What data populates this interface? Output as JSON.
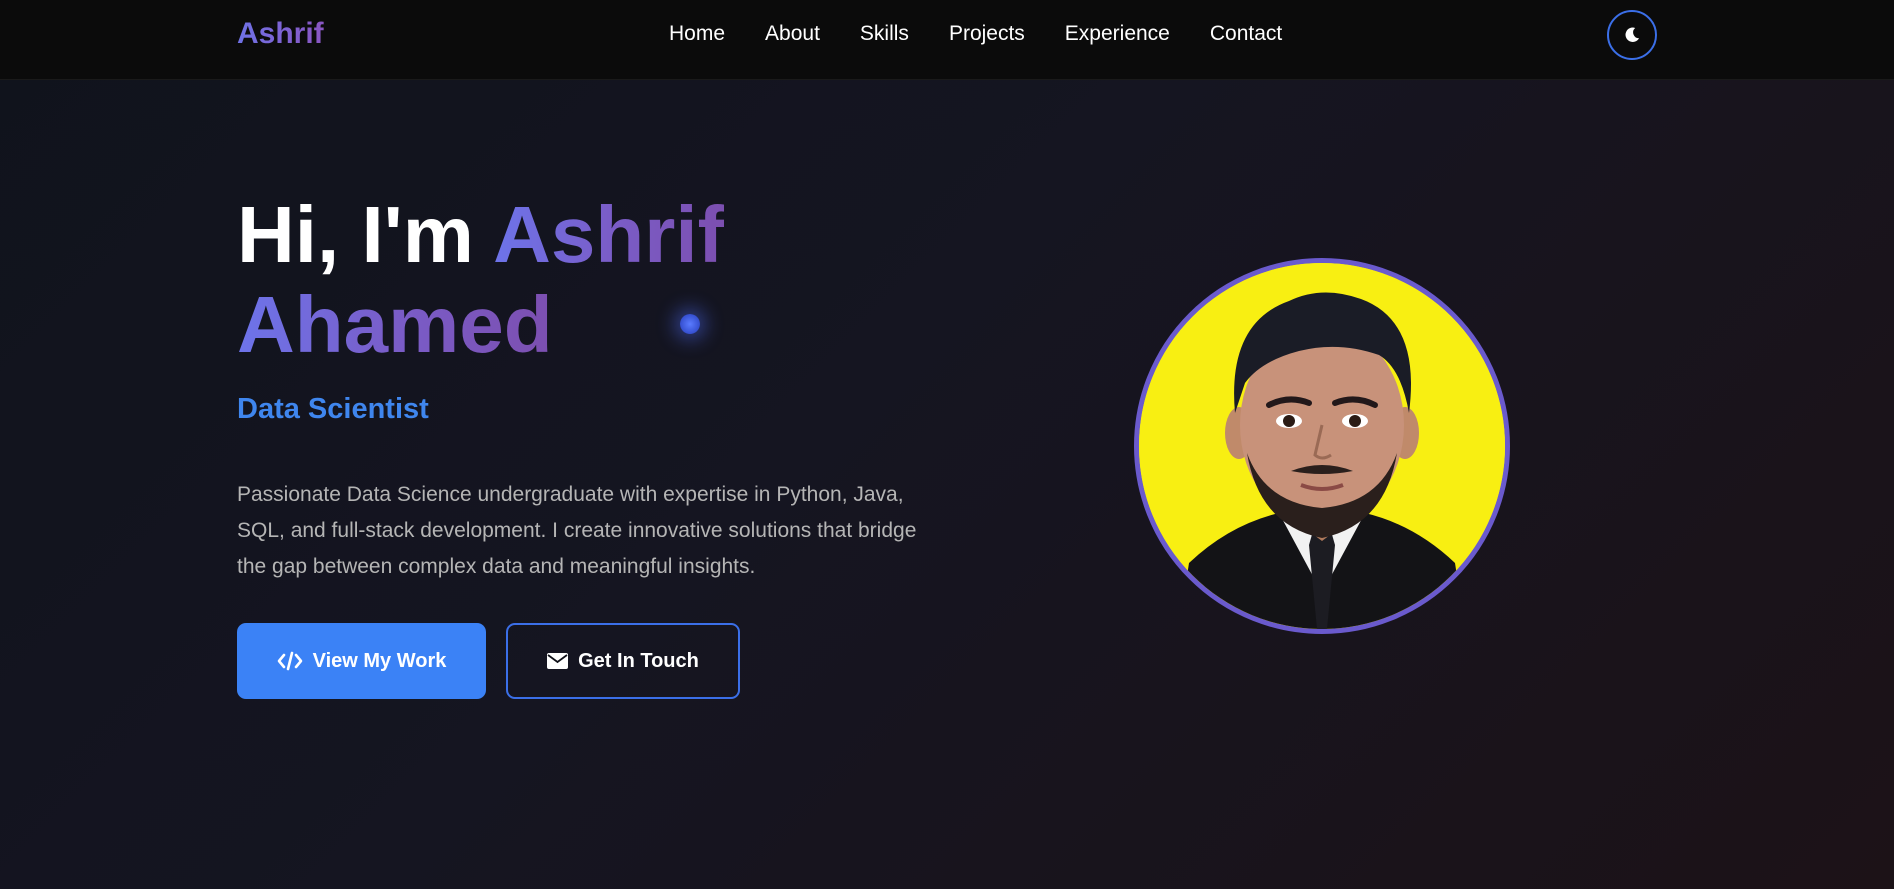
{
  "brand": {
    "name": "Ashrif"
  },
  "nav": {
    "items": [
      {
        "label": "Home"
      },
      {
        "label": "About"
      },
      {
        "label": "Skills"
      },
      {
        "label": "Projects"
      },
      {
        "label": "Experience"
      },
      {
        "label": "Contact"
      }
    ],
    "theme_toggle_icon": "moon-icon"
  },
  "hero": {
    "greeting": "Hi, I'm ",
    "name_first": "Ashrif",
    "name_last": "Ahamed",
    "role": "Data Scientist",
    "description": "Passionate Data Science undergraduate with expertise in Python, Java, SQL, and full-stack development. I create innovative solutions that bridge the gap between complex data and meaningful insights.",
    "primary_button": {
      "label": "View My Work",
      "icon": "code-icon"
    },
    "secondary_button": {
      "label": "Get In Touch",
      "icon": "envelope-icon"
    },
    "profile_photo_background": "#f8ef12"
  },
  "colors": {
    "accent_blue": "#3b82f6",
    "accent_purple": "#6a5acd",
    "nav_background": "#0b0b0b",
    "page_background": "#151521"
  }
}
